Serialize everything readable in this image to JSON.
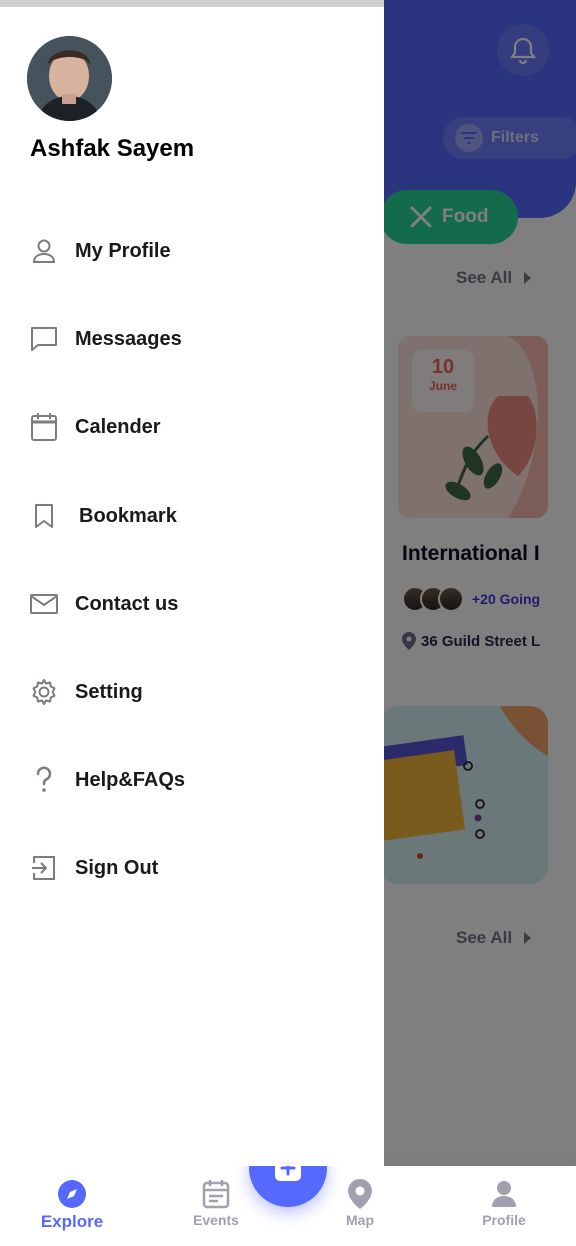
{
  "drawer": {
    "profile_name": "Ashfak Sayem",
    "menu": [
      {
        "label": "My Profile",
        "icon": "person-icon"
      },
      {
        "label": "Messaages",
        "icon": "message-icon"
      },
      {
        "label": "Calender",
        "icon": "calendar-icon"
      },
      {
        "label": "Bookmark",
        "icon": "bookmark-icon"
      },
      {
        "label": "Contact us",
        "icon": "mail-icon"
      },
      {
        "label": "Setting",
        "icon": "gear-icon"
      },
      {
        "label": "Help&FAQs",
        "icon": "question-icon"
      },
      {
        "label": "Sign Out",
        "icon": "sign-out-icon"
      }
    ]
  },
  "background": {
    "filters_label": "Filters",
    "category_chip": "Food",
    "see_all_label": "See All",
    "event": {
      "day": "10",
      "month": "June",
      "title": "International I",
      "going": "+20 Going",
      "address": "36 Guild Street L"
    }
  },
  "bottom_nav": {
    "items": [
      {
        "label": "Explore",
        "icon": "compass-icon",
        "active": true
      },
      {
        "label": "Events",
        "icon": "events-icon",
        "active": false
      },
      {
        "label": "Map",
        "icon": "map-pin-icon",
        "active": false
      },
      {
        "label": "Profile",
        "icon": "profile-icon",
        "active": false
      }
    ],
    "fab_icon": "plus-icon"
  },
  "colors": {
    "primary": "#5669FF",
    "food_green": "#29D697",
    "date_red": "#F0635A",
    "going_blue": "#3F38DD"
  }
}
